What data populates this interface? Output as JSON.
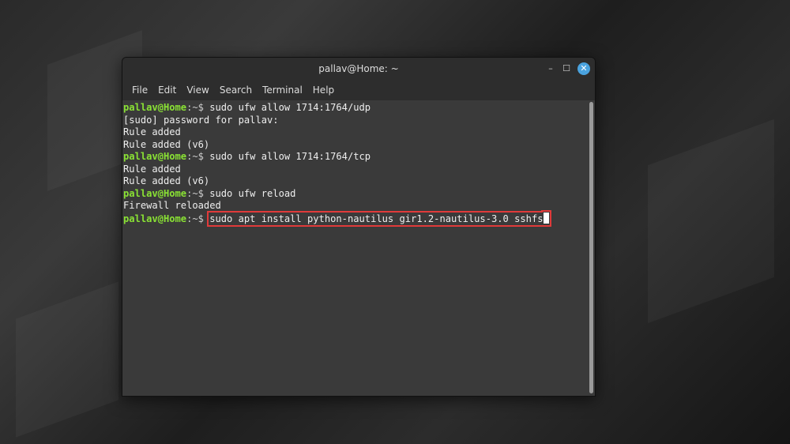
{
  "window": {
    "title": "pallav@Home: ~"
  },
  "menu": [
    "File",
    "Edit",
    "View",
    "Search",
    "Terminal",
    "Help"
  ],
  "terminal": {
    "prompt_user": "pallav@Home",
    "prompt_suffix": ":~$ ",
    "lines": [
      {
        "type": "cmd",
        "text": "sudo ufw allow 1714:1764/udp"
      },
      {
        "type": "out",
        "text": "[sudo] password for pallav:"
      },
      {
        "type": "out",
        "text": "Rule added"
      },
      {
        "type": "out",
        "text": "Rule added (v6)"
      },
      {
        "type": "cmd",
        "text": "sudo ufw allow 1714:1764/tcp"
      },
      {
        "type": "out",
        "text": "Rule added"
      },
      {
        "type": "out",
        "text": "Rule added (v6)"
      },
      {
        "type": "cmd",
        "text": "sudo ufw reload"
      },
      {
        "type": "out",
        "text": "Firewall reloaded"
      }
    ],
    "current_command": "sudo apt install python-nautilus gir1.2-nautilus-3.0 sshfs"
  },
  "colors": {
    "prompt": "#8ae234",
    "highlight": "#e03a3a",
    "close_button": "#4aa3df"
  }
}
